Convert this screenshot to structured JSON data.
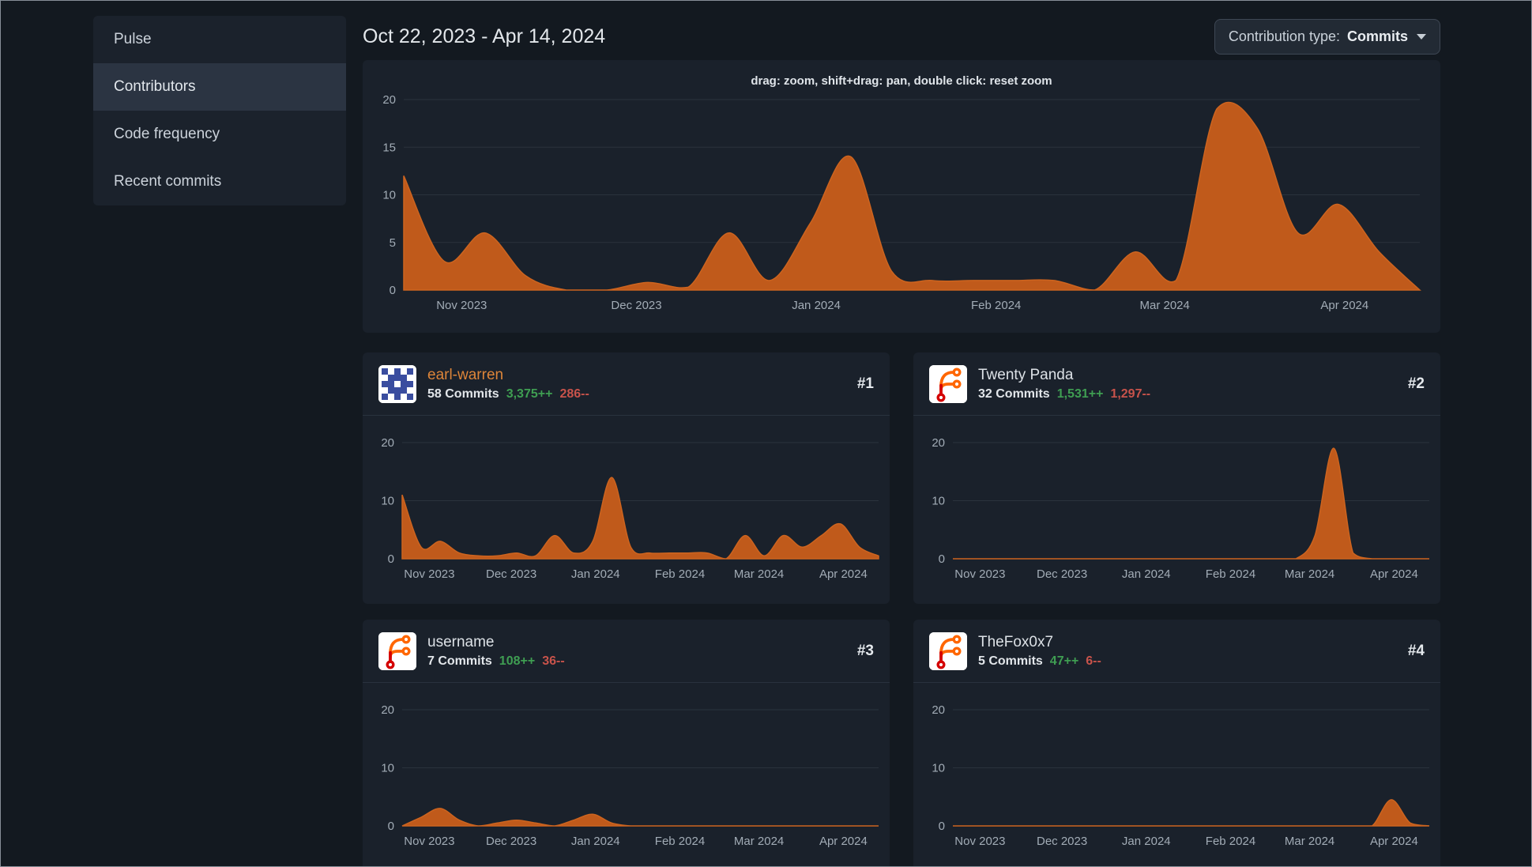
{
  "sidebar": {
    "items": [
      {
        "label": "Pulse",
        "active": false
      },
      {
        "label": "Contributors",
        "active": true
      },
      {
        "label": "Code frequency",
        "active": false
      },
      {
        "label": "Recent commits",
        "active": false
      }
    ]
  },
  "header": {
    "date_range": "Oct 22, 2023 - Apr 14, 2024",
    "contribution_type_label": "Contribution type:",
    "contribution_type_value": "Commits"
  },
  "contributors": [
    {
      "rank": "#1",
      "name": "earl-warren",
      "commits": "58 Commits",
      "additions": "3,375++",
      "deletions": "286--",
      "avatar": "identicon",
      "is_user_link": true
    },
    {
      "rank": "#2",
      "name": "Twenty Panda",
      "commits": "32 Commits",
      "additions": "1,531++",
      "deletions": "1,297--",
      "avatar": "forgejo-logo",
      "is_user_link": false
    },
    {
      "rank": "#3",
      "name": "username",
      "commits": "7 Commits",
      "additions": "108++",
      "deletions": "36--",
      "avatar": "forgejo-logo",
      "is_user_link": false
    },
    {
      "rank": "#4",
      "name": "TheFox0x7",
      "commits": "5 Commits",
      "additions": "47++",
      "deletions": "6--",
      "avatar": "forgejo-logo",
      "is_user_link": false
    }
  ],
  "chart_data": [
    {
      "id": "overall-commits",
      "type": "area",
      "title": "drag: zoom, shift+drag: pan, double click: reset zoom",
      "x_unit": "week",
      "x_range": "Oct 22, 2023 - Apr 14, 2024",
      "values": [
        12,
        3,
        6,
        1.5,
        0,
        0,
        0.8,
        0.3,
        6,
        1,
        7,
        14,
        2,
        1,
        1,
        1,
        1,
        0,
        4,
        1,
        19,
        17,
        6,
        9,
        4,
        0
      ],
      "ylim": [
        0,
        20
      ],
      "y_ticks": [
        0,
        5,
        10,
        15,
        20
      ],
      "x_ticks": [
        {
          "f": 0.057,
          "label": "Nov 2023"
        },
        {
          "f": 0.229,
          "label": "Dec 2023"
        },
        {
          "f": 0.406,
          "label": "Jan 2024"
        },
        {
          "f": 0.583,
          "label": "Feb 2024"
        },
        {
          "f": 0.749,
          "label": "Mar 2024"
        },
        {
          "f": 0.926,
          "label": "Apr 2024"
        }
      ]
    },
    {
      "id": "earl-warren-commits",
      "type": "area",
      "x_unit": "week",
      "values": [
        11,
        2,
        3,
        1,
        0.5,
        0.5,
        1,
        0.5,
        4,
        1,
        3,
        14,
        2,
        1,
        1,
        1,
        1,
        0,
        4,
        0.5,
        4,
        2,
        4,
        6,
        2,
        0.5
      ],
      "ylim": [
        0,
        20
      ],
      "y_ticks": [
        0,
        10,
        20
      ],
      "x_ticks": [
        {
          "f": 0.057,
          "label": "Nov 2023"
        },
        {
          "f": 0.229,
          "label": "Dec 2023"
        },
        {
          "f": 0.406,
          "label": "Jan 2024"
        },
        {
          "f": 0.583,
          "label": "Feb 2024"
        },
        {
          "f": 0.749,
          "label": "Mar 2024"
        },
        {
          "f": 0.926,
          "label": "Apr 2024"
        }
      ]
    },
    {
      "id": "twenty-panda-commits",
      "type": "area",
      "x_unit": "week",
      "values": [
        0,
        0,
        0,
        0,
        0,
        0,
        0,
        0,
        0,
        0,
        0,
        0,
        0,
        0,
        0,
        0,
        0,
        0,
        0,
        4,
        19,
        1,
        0,
        0,
        0,
        0
      ],
      "ylim": [
        0,
        20
      ],
      "y_ticks": [
        0,
        10,
        20
      ],
      "x_ticks": [
        {
          "f": 0.057,
          "label": "Nov 2023"
        },
        {
          "f": 0.229,
          "label": "Dec 2023"
        },
        {
          "f": 0.406,
          "label": "Jan 2024"
        },
        {
          "f": 0.583,
          "label": "Feb 2024"
        },
        {
          "f": 0.749,
          "label": "Mar 2024"
        },
        {
          "f": 0.926,
          "label": "Apr 2024"
        }
      ]
    },
    {
      "id": "username-commits",
      "type": "area",
      "x_unit": "week",
      "values": [
        0,
        1.5,
        3,
        1,
        0,
        0.5,
        1,
        0.5,
        0,
        1,
        2,
        0.5,
        0,
        0,
        0,
        0,
        0,
        0,
        0,
        0,
        0,
        0,
        0,
        0,
        0,
        0
      ],
      "ylim": [
        0,
        20
      ],
      "y_ticks": [
        0,
        10,
        20
      ],
      "x_ticks": [
        {
          "f": 0.057,
          "label": "Nov 2023"
        },
        {
          "f": 0.229,
          "label": "Dec 2023"
        },
        {
          "f": 0.406,
          "label": "Jan 2024"
        },
        {
          "f": 0.583,
          "label": "Feb 2024"
        },
        {
          "f": 0.749,
          "label": "Mar 2024"
        },
        {
          "f": 0.926,
          "label": "Apr 2024"
        }
      ]
    },
    {
      "id": "thefox0x7-commits",
      "type": "area",
      "x_unit": "week",
      "values": [
        0,
        0,
        0,
        0,
        0,
        0,
        0,
        0,
        0,
        0,
        0,
        0,
        0,
        0,
        0,
        0,
        0,
        0,
        0,
        0,
        0,
        0,
        0,
        4.5,
        0.5,
        0
      ],
      "ylim": [
        0,
        20
      ],
      "y_ticks": [
        0,
        10,
        20
      ],
      "x_ticks": [
        {
          "f": 0.057,
          "label": "Nov 2023"
        },
        {
          "f": 0.229,
          "label": "Dec 2023"
        },
        {
          "f": 0.406,
          "label": "Jan 2024"
        },
        {
          "f": 0.583,
          "label": "Feb 2024"
        },
        {
          "f": 0.749,
          "label": "Mar 2024"
        },
        {
          "f": 0.926,
          "label": "Apr 2024"
        }
      ]
    }
  ],
  "colors": {
    "page_bg": "#131920",
    "card_bg": "#1a212b",
    "menu_bg": "#1b222c",
    "menu_active_bg": "#2b3442",
    "divider": "#29323e",
    "grid_line": "#2a323c",
    "tick_text": "#a2acb6",
    "area_fill": "#c05a1b",
    "area_line": "#cd641f",
    "additions_green": "#3f9e52",
    "deletions_red": "#c8534b",
    "link_orange": "#dd8539",
    "text_primary": "#dce1e6",
    "text_secondary": "#aeb7c0",
    "dropdown_bg": "#222a34",
    "dropdown_border": "#3e4754",
    "screen_border": "#878f98"
  }
}
